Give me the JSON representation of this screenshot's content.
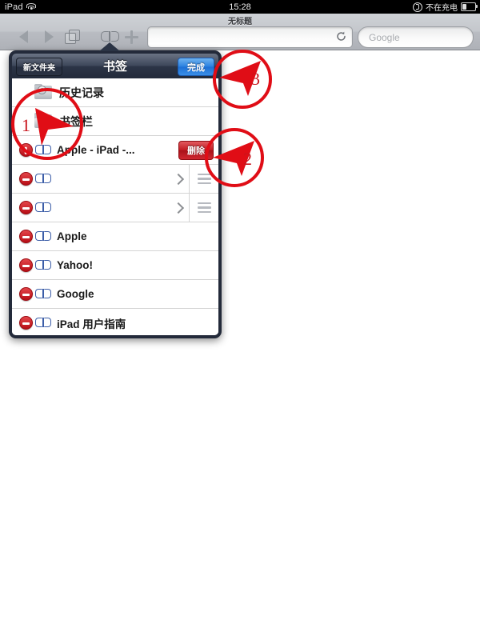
{
  "statusbar": {
    "carrier": "iPad",
    "wifi_icon": "wifi-icon",
    "time": "15:28",
    "lock_icon": "rotation-lock-icon",
    "battery_text": "不在充电",
    "battery_icon": "battery-icon"
  },
  "browser": {
    "page_title": "无标题",
    "back_icon": "back-arrow-icon",
    "forward_icon": "forward-arrow-icon",
    "pages_icon": "pages-icon",
    "bookmarks_icon": "bookmarks-book-icon",
    "add_icon": "plus-icon",
    "address_value": "",
    "address_placeholder": "",
    "reload_icon": "reload-icon",
    "search_placeholder": "Google"
  },
  "popover": {
    "title": "书签",
    "new_folder_label": "新文件夹",
    "done_label": "完成",
    "delete_button_label": "删除",
    "rows": [
      {
        "label": "历史记录",
        "icon": "history-folder-icon",
        "type": "folder",
        "badge": false,
        "chevron": false,
        "handle": false
      },
      {
        "label": "书签栏",
        "icon": "folder-icon",
        "type": "folder",
        "badge": false,
        "chevron": false,
        "handle": false
      },
      {
        "label": "Apple - iPad -...",
        "icon": "bookmark-icon",
        "type": "bookmark",
        "badge": true,
        "badge_open": true,
        "chevron": false,
        "handle": false,
        "delete_visible": true
      },
      {
        "label": "",
        "icon": "bookmark-icon",
        "type": "bookmark",
        "badge": true,
        "badge_open": false,
        "chevron": true,
        "handle": true
      },
      {
        "label": "",
        "icon": "bookmark-icon",
        "type": "bookmark",
        "badge": true,
        "badge_open": false,
        "chevron": true,
        "handle": true
      },
      {
        "label": "Apple",
        "icon": "bookmark-icon",
        "type": "bookmark",
        "badge": true,
        "badge_open": false,
        "chevron": false,
        "handle": false
      },
      {
        "label": "Yahoo!",
        "icon": "bookmark-icon",
        "type": "bookmark",
        "badge": true,
        "badge_open": false,
        "chevron": false,
        "handle": false
      },
      {
        "label": "Google",
        "icon": "bookmark-icon",
        "type": "bookmark",
        "badge": true,
        "badge_open": false,
        "chevron": false,
        "handle": false
      },
      {
        "label": "iPad 用户指南",
        "icon": "bookmark-icon",
        "type": "bookmark",
        "badge": true,
        "badge_open": false,
        "chevron": false,
        "handle": false
      }
    ]
  },
  "annotations": [
    {
      "number": "1",
      "direction": "right",
      "target": "bookmarks-bar-row"
    },
    {
      "number": "2",
      "direction": "left",
      "target": "delete-button"
    },
    {
      "number": "3",
      "direction": "left",
      "target": "done-button"
    }
  ],
  "colors": {
    "accent_red": "#e00d16",
    "done_blue": "#2a80e0",
    "delete_red": "#c0181f",
    "bookmark_icon_blue": "#3c5ea8"
  }
}
